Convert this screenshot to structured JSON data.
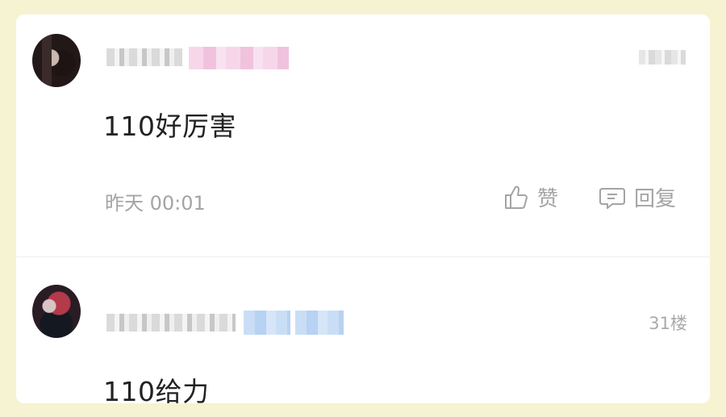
{
  "comments": [
    {
      "content": "110好厉害",
      "time": "昨天 00:01",
      "like_label": "赞",
      "reply_label": "回复"
    },
    {
      "content": "110给力",
      "floor": "31楼"
    }
  ],
  "colors": {
    "page_bg": "#f6f3d3",
    "card_bg": "#ffffff",
    "text": "#222222",
    "muted": "#a4a4a4"
  }
}
